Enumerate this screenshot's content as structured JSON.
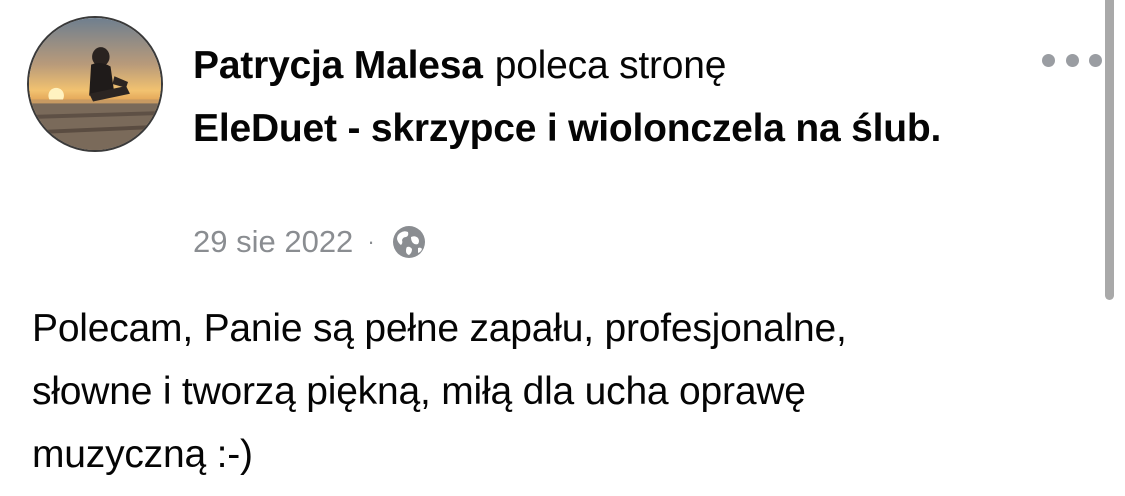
{
  "post": {
    "author": "Patrycja Malesa",
    "action": "poleca stronę",
    "page_name": "EleDuet - skrzypce i wiolonczela na ślub.",
    "date": "29 sie 2022",
    "separator": "·",
    "privacy_icon": "globe-icon",
    "more_icon": "more-options-icon",
    "body_lines": [
      "Polecam, Panie są pełne zapału, profesjonalne,",
      "słowne i tworzą piękną, miłą dla ucha oprawę",
      "muzyczną :-)"
    ]
  }
}
